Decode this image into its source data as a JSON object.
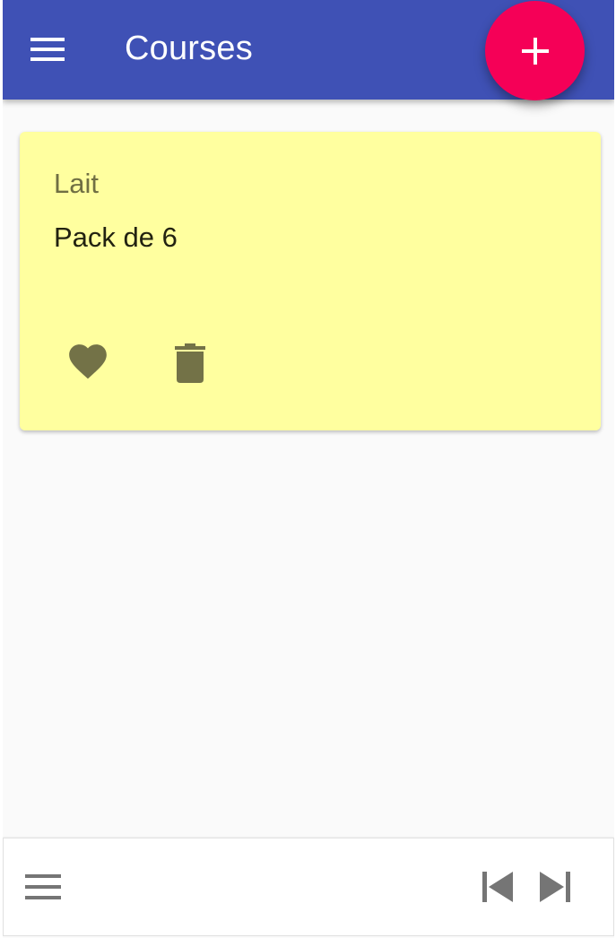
{
  "app_bar": {
    "title": "Courses",
    "color": "#3f51b5",
    "menu_icon": "hamburger-menu-icon"
  },
  "fab": {
    "icon": "plus-icon",
    "color": "#f50057"
  },
  "notes": [
    {
      "title": "Lait",
      "body": "Pack de 6",
      "color": "#ffff9f",
      "actions": [
        "heart-icon",
        "trash-icon"
      ]
    }
  ],
  "bottom_bar": {
    "icons": [
      "hamburger-menu-icon",
      "skip-previous-icon",
      "skip-next-icon"
    ]
  }
}
